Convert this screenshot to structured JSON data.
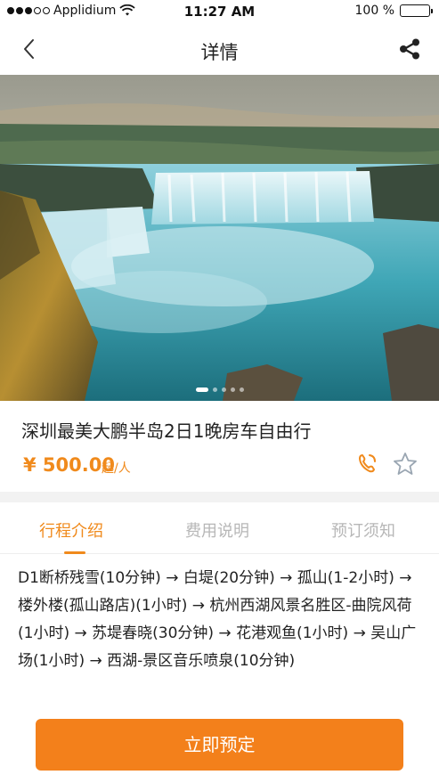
{
  "status_bar": {
    "carrier": "Applidium",
    "time": "11:27 AM",
    "battery": "100 %",
    "signal_icon": "signal-dots-icon",
    "wifi_icon": "wifi-icon",
    "battery_icon": "battery-icon"
  },
  "nav": {
    "title": "详情",
    "back_icon": "chevron-left-icon",
    "share_icon": "share-icon"
  },
  "hero": {
    "image_description_icon": "waterfall-photo",
    "pager": {
      "count": 5,
      "active": 0
    }
  },
  "product": {
    "title": "深圳最美大鹏半岛2日1晚房车自由行",
    "price": "¥ 500.00",
    "price_unit": "起/人",
    "phone_icon": "phone-icon",
    "favorite_icon": "star-outline-icon"
  },
  "tabs": [
    {
      "label": "行程介绍",
      "active": true
    },
    {
      "label": "费用说明",
      "active": false
    },
    {
      "label": "预订须知",
      "active": false
    }
  ],
  "itinerary": {
    "text": "D1断桥残雪(10分钟) → 白堤(20分钟) → 孤山(1-2小时) → 楼外楼(孤山路店)(1小时) → 杭州西湖风景名胜区-曲院风荷(1小时) → 苏堤春晓(30分钟) → 花港观鱼(1小时) → 吴山广场(1小时) → 西湖-景区音乐喷泉(10分钟)"
  },
  "cta": {
    "label": "立即预定"
  },
  "colors": {
    "accent": "#f08a1c",
    "button": "#f3801b",
    "inactive_tab": "#b7b7b7"
  }
}
